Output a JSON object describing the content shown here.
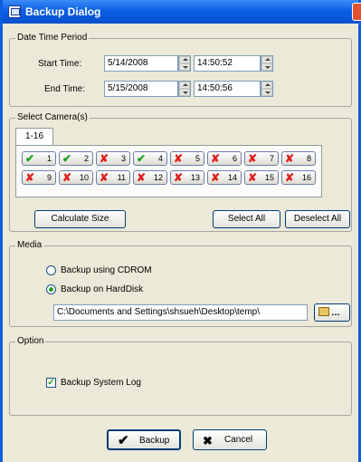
{
  "window": {
    "title": "Backup Dialog"
  },
  "date_time_period": {
    "legend": "Date Time Period",
    "start_label": "Start Time:",
    "start_date": "5/14/2008",
    "start_time": "14:50:52",
    "end_label": "End Time:",
    "end_date": "5/15/2008",
    "end_time": "14:50:56"
  },
  "cameras": {
    "legend": "Select Camera(s)",
    "tab_label": "1-16",
    "items": [
      {
        "num": "1",
        "checked": true
      },
      {
        "num": "2",
        "checked": true
      },
      {
        "num": "3",
        "checked": false
      },
      {
        "num": "4",
        "checked": true
      },
      {
        "num": "5",
        "checked": false
      },
      {
        "num": "6",
        "checked": false
      },
      {
        "num": "7",
        "checked": false
      },
      {
        "num": "8",
        "checked": false
      },
      {
        "num": "9",
        "checked": false
      },
      {
        "num": "10",
        "checked": false
      },
      {
        "num": "11",
        "checked": false
      },
      {
        "num": "12",
        "checked": false
      },
      {
        "num": "13",
        "checked": false
      },
      {
        "num": "14",
        "checked": false
      },
      {
        "num": "15",
        "checked": false
      },
      {
        "num": "16",
        "checked": false
      }
    ],
    "calculate_label": "Calculate Size",
    "select_all_label": "Select All",
    "deselect_all_label": "Deselect All"
  },
  "media": {
    "legend": "Media",
    "cdrom_label": "Backup using CDROM",
    "harddisk_label": "Backup on HardDisk",
    "selected": "harddisk",
    "path": "C:\\Documents and Settings\\shsueh\\Desktop\\temp\\"
  },
  "option": {
    "legend": "Option",
    "system_log_label": "Backup System Log",
    "system_log_checked": true
  },
  "footer": {
    "backup_label": "Backup",
    "cancel_label": "Cancel"
  }
}
